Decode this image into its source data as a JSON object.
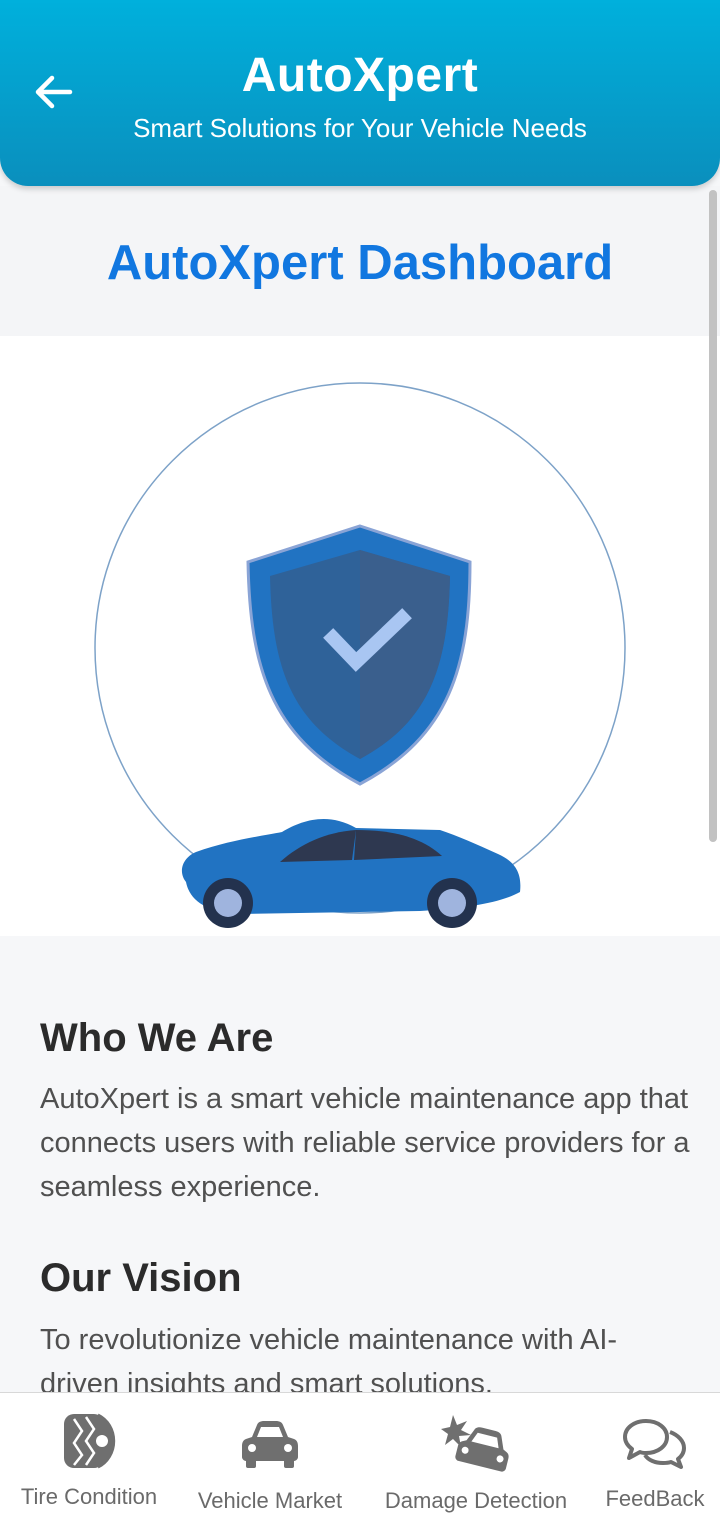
{
  "header": {
    "title": "AutoXpert",
    "subtitle": "Smart Solutions for Your Vehicle Needs",
    "back_icon": "arrow-left-icon"
  },
  "dashboard": {
    "title": "AutoXpert Dashboard"
  },
  "hero": {
    "illustration_icons": [
      "shield-check-icon",
      "car-icon"
    ],
    "accent_color": "#1e73be"
  },
  "about": {
    "who_heading": "Who We Are",
    "who_text": "AutoXpert is a smart vehicle maintenance app that connects users with reliable service providers for a seamless experience.",
    "vision_heading": "Our Vision",
    "vision_text": "To revolutionize vehicle maintenance with AI-driven insights and smart solutions."
  },
  "bottom_nav": {
    "items": [
      {
        "label": "Tire Condition",
        "icon": "tire-icon"
      },
      {
        "label": "Vehicle Market",
        "icon": "car-front-icon"
      },
      {
        "label": "Damage Detection",
        "icon": "car-crash-icon"
      },
      {
        "label": "FeedBack",
        "icon": "chat-bubbles-icon"
      }
    ]
  },
  "colors": {
    "header_gradient_top": "#00b0dc",
    "header_gradient_bottom": "#0a8fbd",
    "dashboard_title": "#1177e0",
    "nav_icon": "#6f6f6f"
  }
}
